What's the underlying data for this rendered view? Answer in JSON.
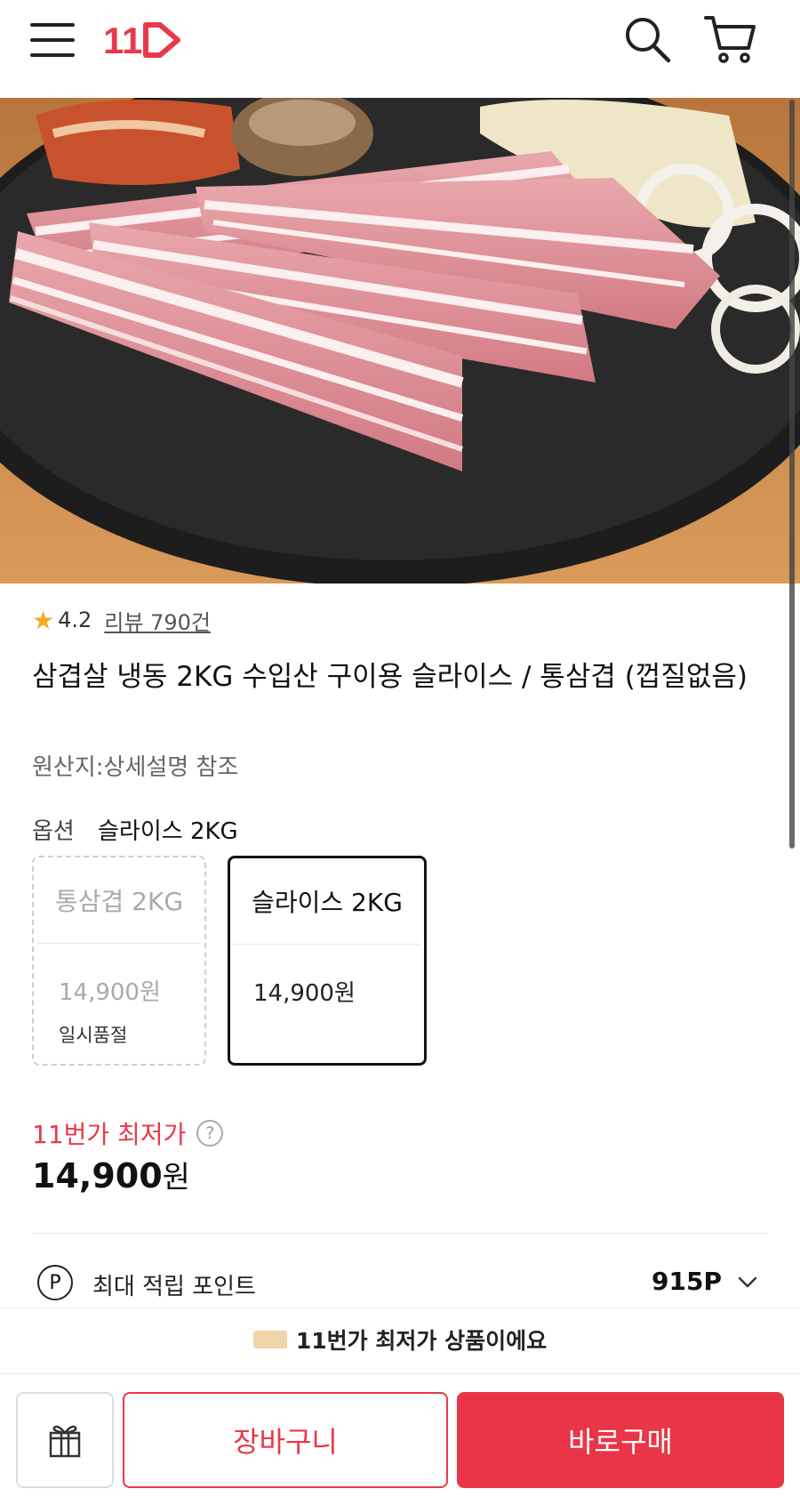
{
  "header": {
    "logo_text": "11",
    "icons": [
      "hamburger-menu-icon",
      "search-icon",
      "cart-icon"
    ],
    "accent_color": "#e8394a"
  },
  "product": {
    "rating": "4.2",
    "review_text": "리뷰 790건",
    "title": "삼겹살 냉동 2KG 수입산 구이용 슬라이스 / 통삼겹 (껍질없음)",
    "origin": "원산지:상세설명 참조"
  },
  "options": {
    "label": "옵션",
    "selected": "슬라이스 2KG",
    "cards": [
      {
        "name": "통삼겹 2KG",
        "price": "14,900원",
        "status": "일시품절",
        "state": "sold-out"
      },
      {
        "name": "슬라이스 2KG",
        "price": "14,900원",
        "status": "",
        "state": "selected"
      }
    ]
  },
  "pricing": {
    "lowest_label": "11번가 최저가",
    "help_glyph": "?",
    "amount": "14,900",
    "unit": "원"
  },
  "points": {
    "icon_glyph": "P",
    "label": "최대 적립 포인트",
    "value": "915P"
  },
  "banner": {
    "text": "11번가 최저가 상품이에요"
  },
  "actions": {
    "cart_label": "장바구니",
    "buy_label": "바로구매",
    "buy_color": "#ea3548"
  }
}
